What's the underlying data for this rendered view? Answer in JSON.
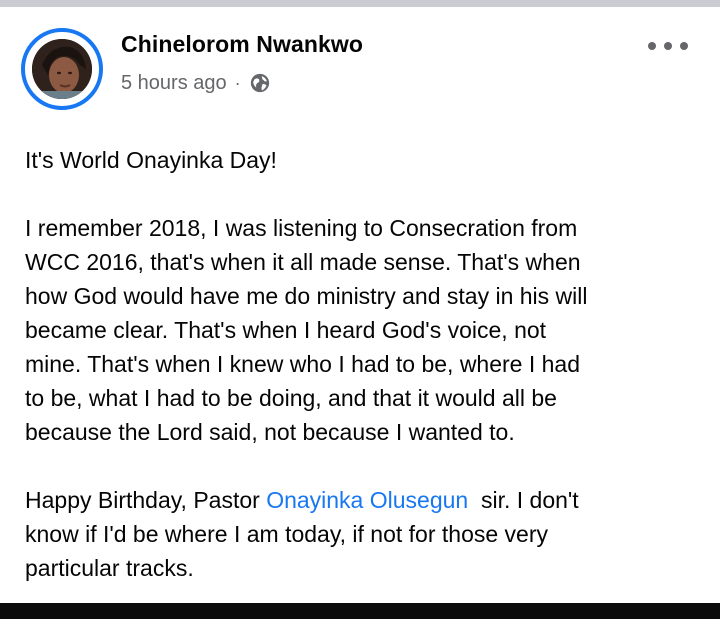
{
  "post": {
    "author": "Chinelorom Nwankwo",
    "timestamp": "5 hours ago",
    "separator": "·",
    "privacy_icon": "globe-icon",
    "menu_icon": "more-options-icon",
    "paragraph1": "It's World Onayinka Day!",
    "paragraph2_lines": [
      "I remember 2018, I was listening to Consecration from",
      "WCC 2016, that's when it all made sense. That's when",
      "how God would have me do ministry and stay in his will",
      "became clear. That's when I heard God's voice, not",
      "mine. That's when I knew who I had to be, where I had",
      "to be, what I had to be doing, and that it would all be",
      "because the Lord said, not because I wanted to."
    ],
    "paragraph3": {
      "before_mention": "Happy Birthday, Pastor ",
      "mention": "Onayinka Olusegun",
      "after_mention": "  sir. I don't",
      "lines": [
        "know if I'd be where I am today, if not for those very",
        "particular tracks."
      ]
    }
  },
  "colors": {
    "accent": "#1877f2",
    "text": "#050505",
    "secondary_text": "#65676b"
  }
}
